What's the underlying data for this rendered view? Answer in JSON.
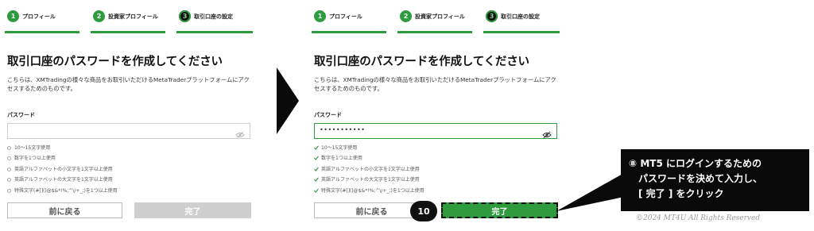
{
  "colors": {
    "accent": "#2e9b3e",
    "disabled_button": "#cfcfcf",
    "callout_bg": "#0a0a0a"
  },
  "steps": [
    {
      "num": "1",
      "label": "プロフィール"
    },
    {
      "num": "2",
      "label": "投資家プロフィール"
    },
    {
      "num": "3",
      "label": "取引口座の設定"
    }
  ],
  "form": {
    "title": "取引口座のパスワードを作成してください",
    "description": "こちらは、XMTradingの様々な商品をお取引いただけるMetaTraderプラットフォームにアクセスするためのものです。",
    "password_label": "パスワード",
    "requirements": [
      "10～15文字使用",
      "数字を1つ以上使用",
      "英語アルファベットの小文字を1文字以上使用",
      "英語アルファベットの大文字を1文字以上使用",
      "特殊文字(#[]()@$&*!%;^\\/+_;)を1つ以上使用"
    ],
    "back_label": "前に戻る",
    "complete_label": "完了"
  },
  "left": {
    "password_value": ""
  },
  "right": {
    "password_value": "•••••••••••"
  },
  "icons": {
    "toggle_visibility": "eye-slash-icon",
    "requirement_pending": "circle-icon",
    "requirement_met": "check-icon"
  },
  "annotation": {
    "step_number": "10",
    "callout_lines": [
      "⑧ MT5 にログインするための",
      "パスワードを決めて入力し、",
      "[ 完了 ] をクリック"
    ]
  },
  "copyright": "©2024 MT4U All Rights Reserved"
}
